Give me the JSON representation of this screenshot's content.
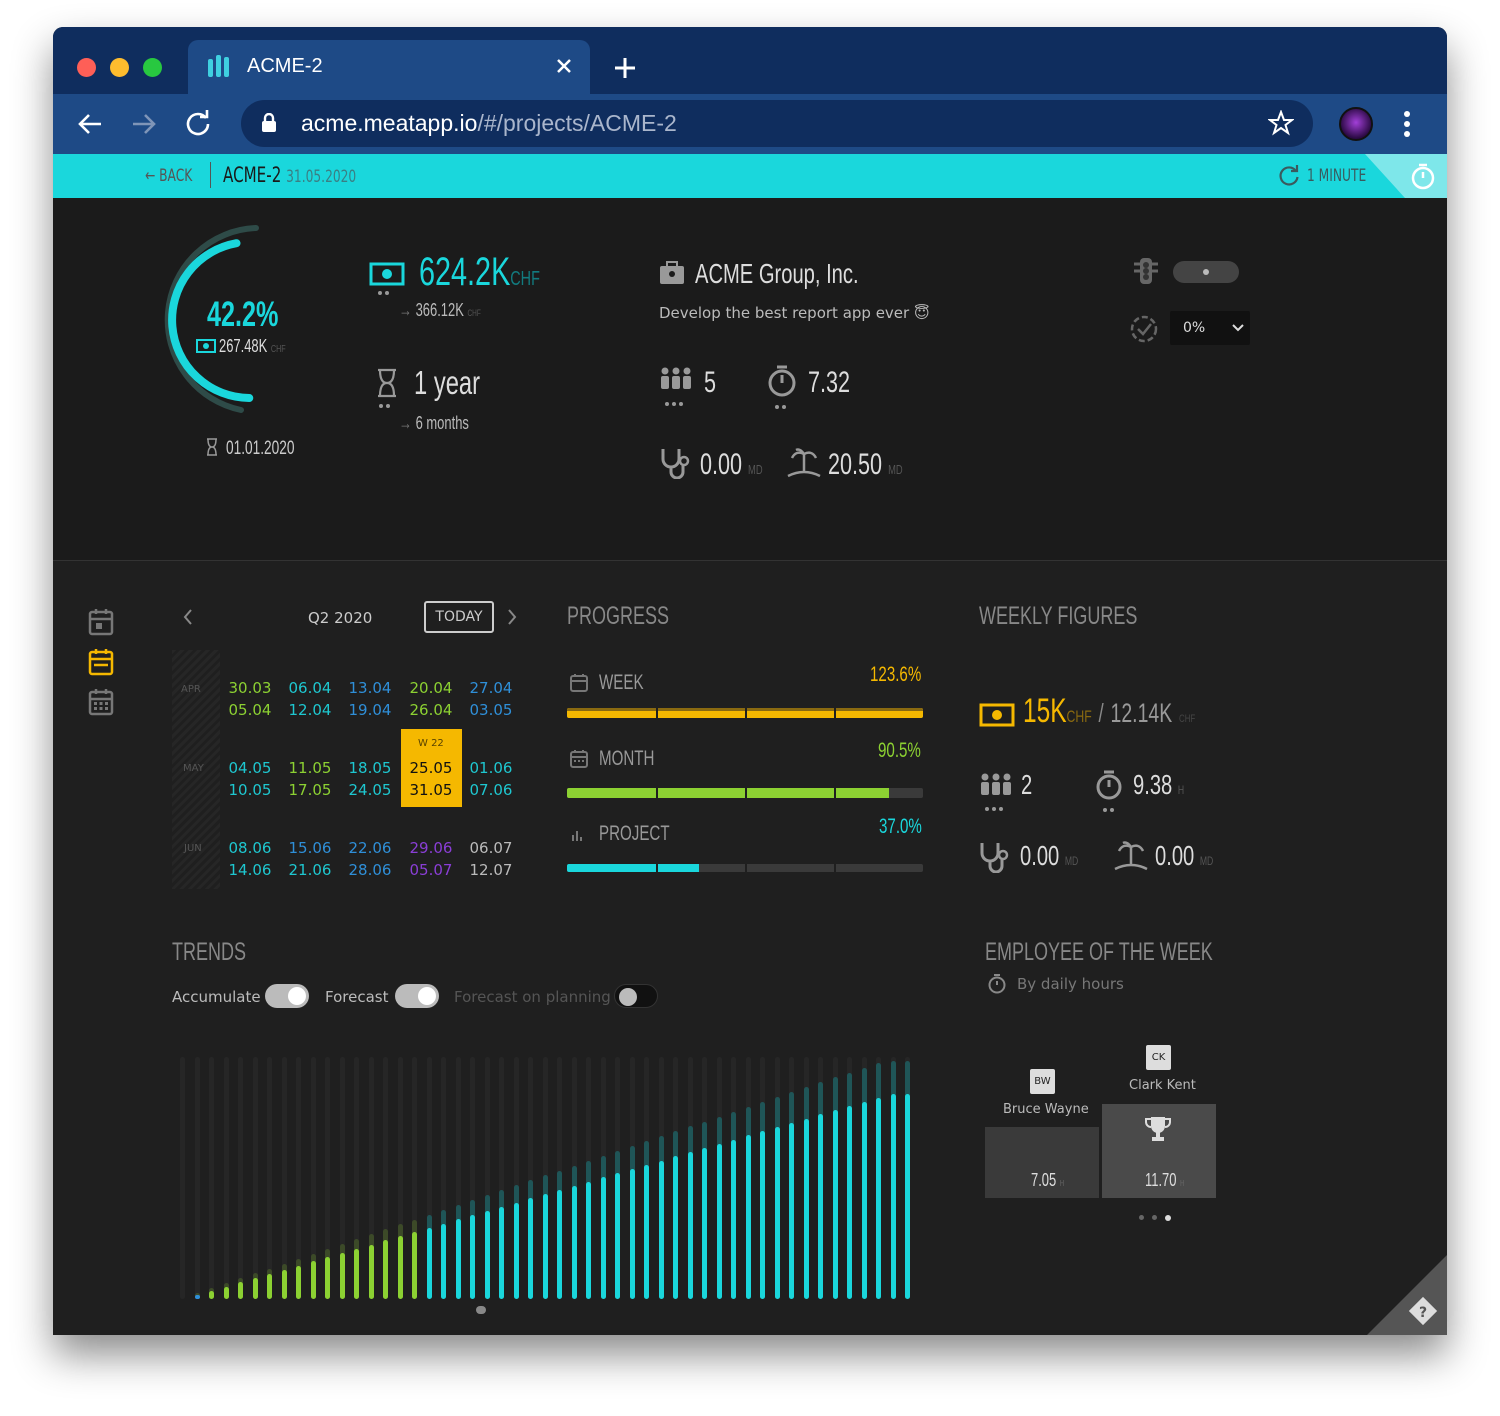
{
  "browser": {
    "tab_title": "ACME-2",
    "url_domain": "acme.meatapp.io",
    "url_path": "/#/projects/ACME-2"
  },
  "topbar": {
    "back": "BACK",
    "project": "ACME-2",
    "date": "31.05.2020",
    "refresh": "1 MINUTE"
  },
  "summary": {
    "gauge_percent": "42.2%",
    "gauge_percent_value": 0.422,
    "gauge_amount": "267.48K",
    "gauge_currency": "CHF",
    "start_date": "01.01.2020",
    "budget": "624.2K",
    "budget_currency": "CHF",
    "budget_sub": "366.12K",
    "budget_sub_currency": "CHF",
    "duration": "1 year",
    "duration_sub": "6 months",
    "client": "ACME Group, Inc.",
    "description": "Develop the best report app ever 😇",
    "members": "5",
    "hours": "7.32",
    "sick": "0.00",
    "sick_unit": "MD",
    "vacation": "20.50",
    "vacation_unit": "MD",
    "select_value": "0%"
  },
  "calendar": {
    "quarter": "Q2 2020",
    "today": "TODAY",
    "months": [
      "APR",
      "MAY",
      "JUN"
    ],
    "week_label": "W 22",
    "rows": [
      [
        [
          "30.03",
          "g"
        ],
        [
          "06.04",
          "c"
        ],
        [
          "13.04",
          "b"
        ],
        [
          "20.04",
          "g"
        ],
        [
          "27.04",
          "b"
        ]
      ],
      [
        [
          "05.04",
          "g"
        ],
        [
          "12.04",
          "c"
        ],
        [
          "19.04",
          "b"
        ],
        [
          "26.04",
          "g"
        ],
        [
          "03.05",
          "b"
        ]
      ],
      [
        [
          "04.05",
          "c"
        ],
        [
          "11.05",
          "g"
        ],
        [
          "18.05",
          "c"
        ],
        [
          "25.05",
          "k"
        ],
        [
          "01.06",
          "c"
        ]
      ],
      [
        [
          "10.05",
          "c"
        ],
        [
          "17.05",
          "g"
        ],
        [
          "24.05",
          "c"
        ],
        [
          "31.05",
          "k"
        ],
        [
          "07.06",
          "c"
        ]
      ],
      [
        [
          "08.06",
          "c"
        ],
        [
          "15.06",
          "b"
        ],
        [
          "22.06",
          "b"
        ],
        [
          "29.06",
          "p"
        ],
        [
          "06.07",
          "w"
        ]
      ],
      [
        [
          "14.06",
          "c"
        ],
        [
          "21.06",
          "c"
        ],
        [
          "28.06",
          "b"
        ],
        [
          "05.07",
          "p"
        ],
        [
          "12.07",
          "w"
        ]
      ]
    ]
  },
  "progress": {
    "title": "PROGRESS",
    "week_label": "WEEK",
    "week_pct": "123.6%",
    "week_value": 1.236,
    "month_label": "MONTH",
    "month_pct": "90.5%",
    "month_value": 0.905,
    "project_label": "PROJECT",
    "project_pct": "37.0%",
    "project_value": 0.37
  },
  "weekly": {
    "title": "WEEKLY FIGURES",
    "amount": "15K",
    "amount_currency": "CHF",
    "sep": "/",
    "amount2": "12.14K",
    "amount2_currency": "CHF",
    "members": "2",
    "hours": "9.38",
    "hours_unit": "H",
    "sick": "0.00",
    "sick_unit": "MD",
    "vacation": "0.00",
    "vacation_unit": "MD"
  },
  "trends": {
    "title": "TRENDS",
    "accumulate": "Accumulate",
    "forecast": "Forecast",
    "forecast_planning": "Forecast on planning"
  },
  "employee": {
    "title": "EMPLOYEE OF THE WEEK",
    "subtitle": "By daily hours",
    "e1_initials": "BW",
    "e1_name": "Bruce Wayne",
    "e1_value": "7.05",
    "e1_unit": "H",
    "e2_initials": "CK",
    "e2_name": "Clark Kent",
    "e2_value": "11.70",
    "e2_unit": "H"
  },
  "colors": {
    "cyan": "#1ad7dc",
    "yellow": "#f5b800",
    "green": "#8cd132",
    "dark": "#1f1f1f"
  }
}
